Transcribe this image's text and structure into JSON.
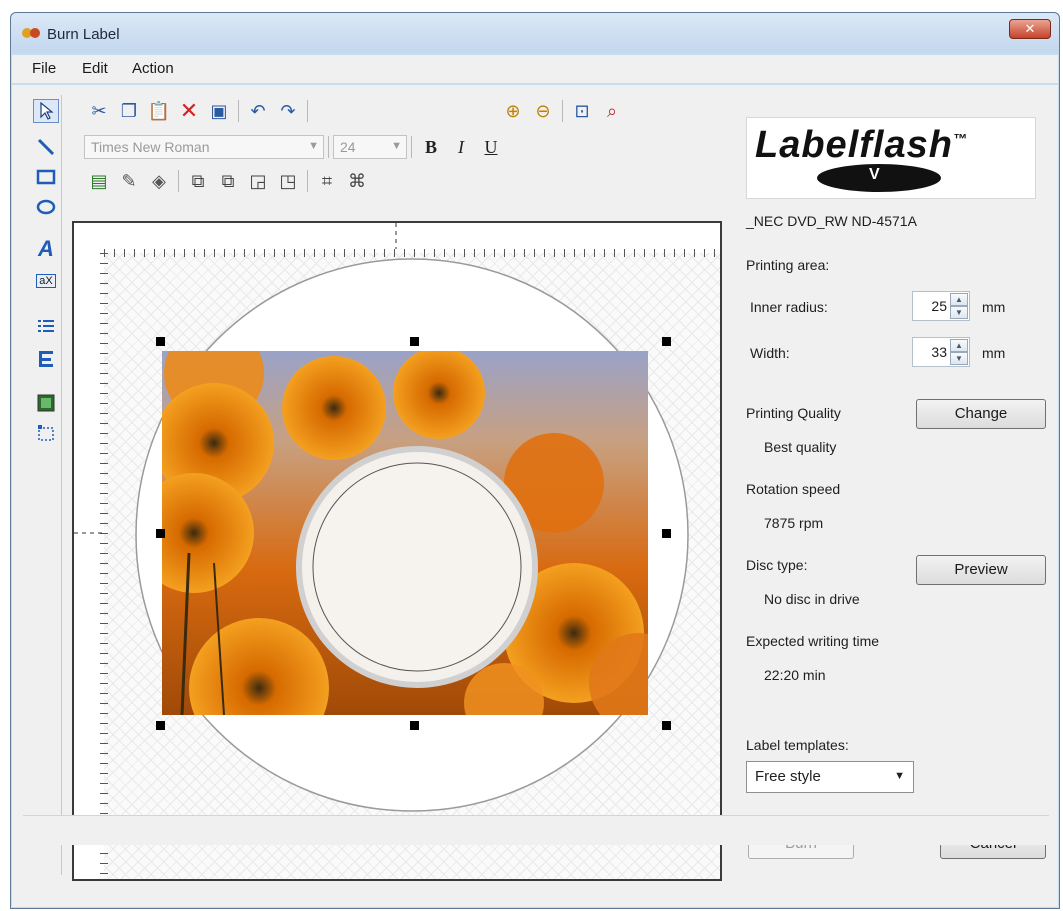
{
  "window": {
    "title": "Burn Label"
  },
  "menu": {
    "file": "File",
    "edit": "Edit",
    "action": "Action"
  },
  "toolbar": {
    "font_name": "Times New Roman",
    "font_size": "24",
    "bold": "B",
    "italic": "I",
    "underline": "U"
  },
  "panel": {
    "logo_text": "Labelflash",
    "logo_tm": "™",
    "logo_v": "V",
    "drive": "_NEC DVD_RW ND-4571A",
    "printing_area_label": "Printing area:",
    "inner_radius_label": "Inner radius:",
    "inner_radius_value": "25",
    "inner_radius_unit": "mm",
    "width_label": "Width:",
    "width_value": "33",
    "width_unit": "mm",
    "printing_quality_label": "Printing Quality",
    "printing_quality_value": "Best quality",
    "change_button": "Change",
    "rotation_speed_label": "Rotation speed",
    "rotation_speed_value": "7875 rpm",
    "disc_type_label": "Disc type:",
    "disc_type_value": "No disc in drive",
    "preview_button": "Preview",
    "writing_time_label": "Expected writing time",
    "writing_time_value": "22:20 min",
    "label_templates_label": "Label templates:",
    "label_template_selected": "Free style",
    "burn_button": "Burn",
    "cancel_button": "Cancel"
  }
}
